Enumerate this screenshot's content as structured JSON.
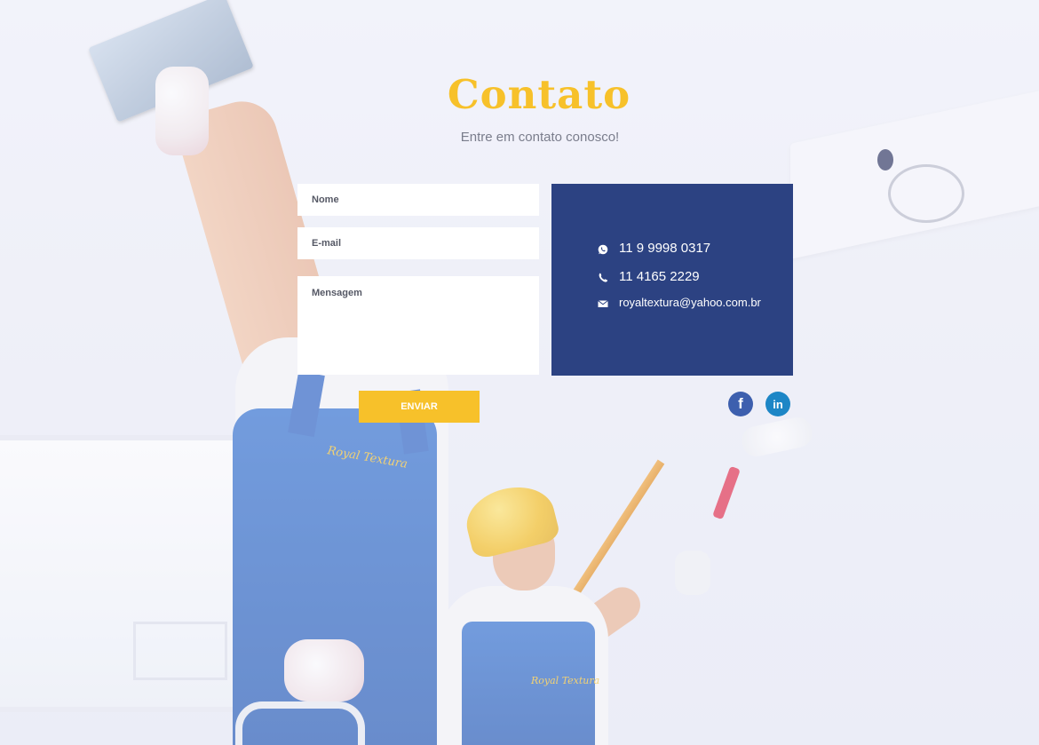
{
  "header": {
    "title": "Contato",
    "subtitle": "Entre em contato conosco!"
  },
  "form": {
    "name_placeholder": "Nome",
    "email_placeholder": "E-mail",
    "message_placeholder": "Mensagem",
    "submit_label": "ENVIAR"
  },
  "contact": {
    "whatsapp": "11 9 9998 0317",
    "phone": "11 4165 2229",
    "email": "royaltextura@yahoo.com.br"
  },
  "social": {
    "facebook_label": "f",
    "linkedin_label": "in"
  },
  "scene": {
    "overall_logo_text": "Royal Textura"
  },
  "colors": {
    "accent": "#f7c12a",
    "info_panel": "#2c4282",
    "facebook": "#3d5fae",
    "linkedin": "#1d86c6"
  }
}
